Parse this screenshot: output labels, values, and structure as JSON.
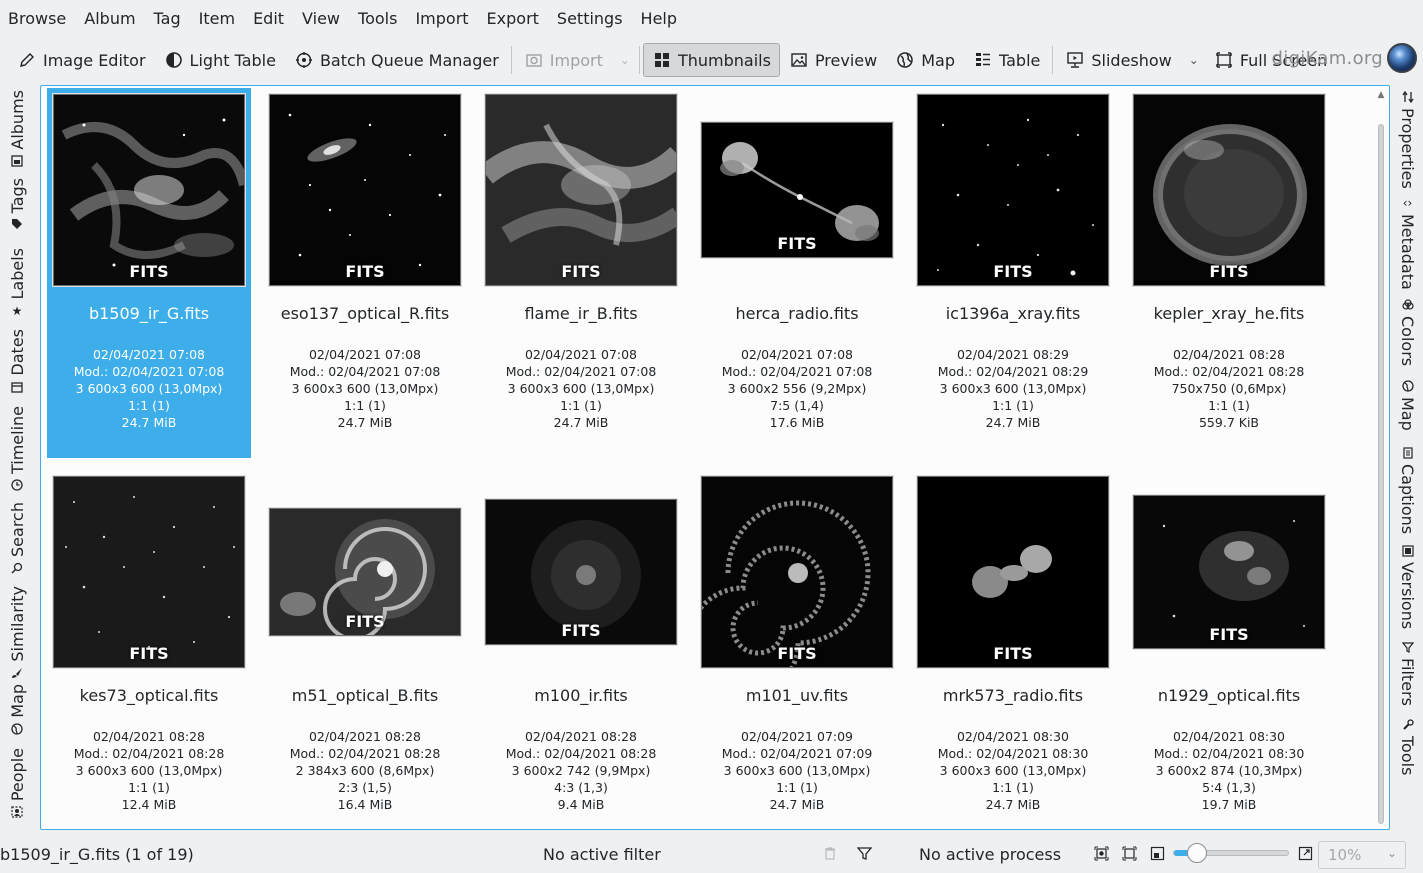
{
  "menu": [
    "Browse",
    "Album",
    "Tag",
    "Item",
    "Edit",
    "View",
    "Tools",
    "Import",
    "Export",
    "Settings",
    "Help"
  ],
  "toolbar": {
    "image_editor": "Image Editor",
    "light_table": "Light Table",
    "batch_queue_manager": "Batch Queue Manager",
    "import": "Import",
    "thumbnails": "Thumbnails",
    "preview": "Preview",
    "map": "Map",
    "table": "Table",
    "slideshow": "Slideshow",
    "full_screen": "Full Screen",
    "brand": "digiKam.org"
  },
  "left_tabs": [
    "Albums",
    "Tags",
    "Labels",
    "Dates",
    "Timeline",
    "Search",
    "Similarity",
    "Map",
    "People"
  ],
  "right_tabs": [
    "Properties",
    "Metadata",
    "Colors",
    "Map",
    "Captions",
    "Versions",
    "Filters",
    "Tools"
  ],
  "badge": "FITS",
  "items": [
    {
      "name": "b1509_ir_G.fits",
      "date": "02/04/2021 07:08",
      "mod": "Mod.: 02/04/2021 07:08",
      "dims": "3 600x3 600 (13,0Mpx)",
      "ratio": "1:1 (1)",
      "size": "24.7 MiB"
    },
    {
      "name": "eso137_optical_R.fits",
      "date": "02/04/2021 07:08",
      "mod": "Mod.: 02/04/2021 07:08",
      "dims": "3 600x3 600 (13,0Mpx)",
      "ratio": "1:1 (1)",
      "size": "24.7 MiB"
    },
    {
      "name": "flame_ir_B.fits",
      "date": "02/04/2021 07:08",
      "mod": "Mod.: 02/04/2021 07:08",
      "dims": "3 600x3 600 (13,0Mpx)",
      "ratio": "1:1 (1)",
      "size": "24.7 MiB"
    },
    {
      "name": "herca_radio.fits",
      "date": "02/04/2021 07:08",
      "mod": "Mod.: 02/04/2021 07:08",
      "dims": "3 600x2 556 (9,2Mpx)",
      "ratio": "7:5 (1,4)",
      "size": "17.6 MiB"
    },
    {
      "name": "ic1396a_xray.fits",
      "date": "02/04/2021 08:29",
      "mod": "Mod.: 02/04/2021 08:29",
      "dims": "3 600x3 600 (13,0Mpx)",
      "ratio": "1:1 (1)",
      "size": "24.7 MiB"
    },
    {
      "name": "kepler_xray_he.fits",
      "date": "02/04/2021 08:28",
      "mod": "Mod.: 02/04/2021 08:28",
      "dims": "750x750 (0,6Mpx)",
      "ratio": "1:1 (1)",
      "size": "559.7 KiB"
    },
    {
      "name": "kes73_optical.fits",
      "date": "02/04/2021 08:28",
      "mod": "Mod.: 02/04/2021 08:28",
      "dims": "3 600x3 600 (13,0Mpx)",
      "ratio": "1:1 (1)",
      "size": "12.4 MiB"
    },
    {
      "name": "m51_optical_B.fits",
      "date": "02/04/2021 08:28",
      "mod": "Mod.: 02/04/2021 08:28",
      "dims": "2 384x3 600 (8,6Mpx)",
      "ratio": "2:3 (1,5)",
      "size": "16.4 MiB"
    },
    {
      "name": "m100_ir.fits",
      "date": "02/04/2021 08:28",
      "mod": "Mod.: 02/04/2021 08:28",
      "dims": "3 600x2 742 (9,9Mpx)",
      "ratio": "4:3 (1,3)",
      "size": "9.4 MiB"
    },
    {
      "name": "m101_uv.fits",
      "date": "02/04/2021 07:09",
      "mod": "Mod.: 02/04/2021 07:09",
      "dims": "3 600x3 600 (13,0Mpx)",
      "ratio": "1:1 (1)",
      "size": "24.7 MiB"
    },
    {
      "name": "mrk573_radio.fits",
      "date": "02/04/2021 08:30",
      "mod": "Mod.: 02/04/2021 08:30",
      "dims": "3 600x3 600 (13,0Mpx)",
      "ratio": "1:1 (1)",
      "size": "24.7 MiB"
    },
    {
      "name": "n1929_optical.fits",
      "date": "02/04/2021 08:30",
      "mod": "Mod.: 02/04/2021 08:30",
      "dims": "3 600x2 874 (10,3Mpx)",
      "ratio": "5:4 (1,3)",
      "size": "19.7 MiB"
    }
  ],
  "status": {
    "selection": "b1509_ir_G.fits (1 of 19)",
    "filter": "No active filter",
    "process": "No active process",
    "zoom_value": "10%",
    "zoom_level": 0.2
  }
}
